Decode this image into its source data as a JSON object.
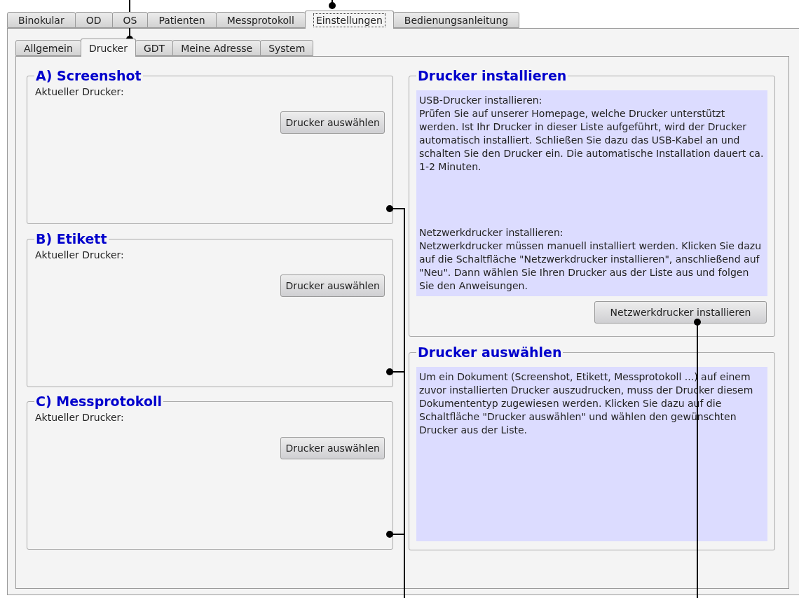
{
  "main_tabs": [
    {
      "label": "Binokular",
      "selected": false,
      "focused": false
    },
    {
      "label": "OD",
      "selected": false,
      "focused": false
    },
    {
      "label": "OS",
      "selected": false,
      "focused": false
    },
    {
      "label": "Patienten",
      "selected": false,
      "focused": false
    },
    {
      "label": "Messprotokoll",
      "selected": false,
      "focused": false
    },
    {
      "label": "Einstellungen",
      "selected": true,
      "focused": true
    },
    {
      "label": "Bedienungsanleitung",
      "selected": false,
      "focused": false
    }
  ],
  "sub_tabs": [
    {
      "label": "Allgemein",
      "selected": false
    },
    {
      "label": "Drucker",
      "selected": true
    },
    {
      "label": "GDT",
      "selected": false
    },
    {
      "label": "Meine Adresse",
      "selected": false
    },
    {
      "label": "System",
      "selected": false
    }
  ],
  "printer_groups": [
    {
      "title": "A) Screenshot",
      "label": "Aktueller Drucker:",
      "button": "Drucker auswählen"
    },
    {
      "title": "B) Etikett",
      "label": "Aktueller Drucker:",
      "button": "Drucker auswählen"
    },
    {
      "title": "C) Messprotokoll",
      "label": "Aktueller Drucker:",
      "button": "Drucker auswählen"
    }
  ],
  "install_group": {
    "title": "Drucker installieren",
    "blocks": [
      {
        "heading": "USB-Drucker installieren:",
        "text": "Prüfen Sie auf unserer Homepage, welche Drucker unterstützt werden. Ist Ihr Drucker in dieser Liste aufgeführt, wird der Drucker automatisch installiert. Schließen Sie dazu das USB-Kabel an und schalten Sie den Drucker ein. Die automatische Installation dauert ca. 1-2 Minuten."
      },
      {
        "heading": "Netzwerkdrucker installieren:",
        "text": "Netzwerkdrucker müssen manuell installiert werden. Klicken Sie dazu auf die Schaltfläche \"Netzwerkdrucker installieren\", anschließend auf \"Neu\". Dann wählen Sie Ihren Drucker aus der Liste aus und folgen Sie den Anweisungen."
      }
    ],
    "button": "Netzwerkdrucker installieren"
  },
  "select_group": {
    "title": "Drucker auswählen",
    "text": "Um ein Dokument (Screenshot, Etikett, Messprotokoll ...) auf einem zuvor installierten Drucker auszudrucken, muss der Drucker diesem Dokumententyp zugewiesen werden. Klicken Sie dazu auf die Schaltfläche \"Drucker auswählen\" und wählen den gewünschten Drucker aus der Liste."
  }
}
